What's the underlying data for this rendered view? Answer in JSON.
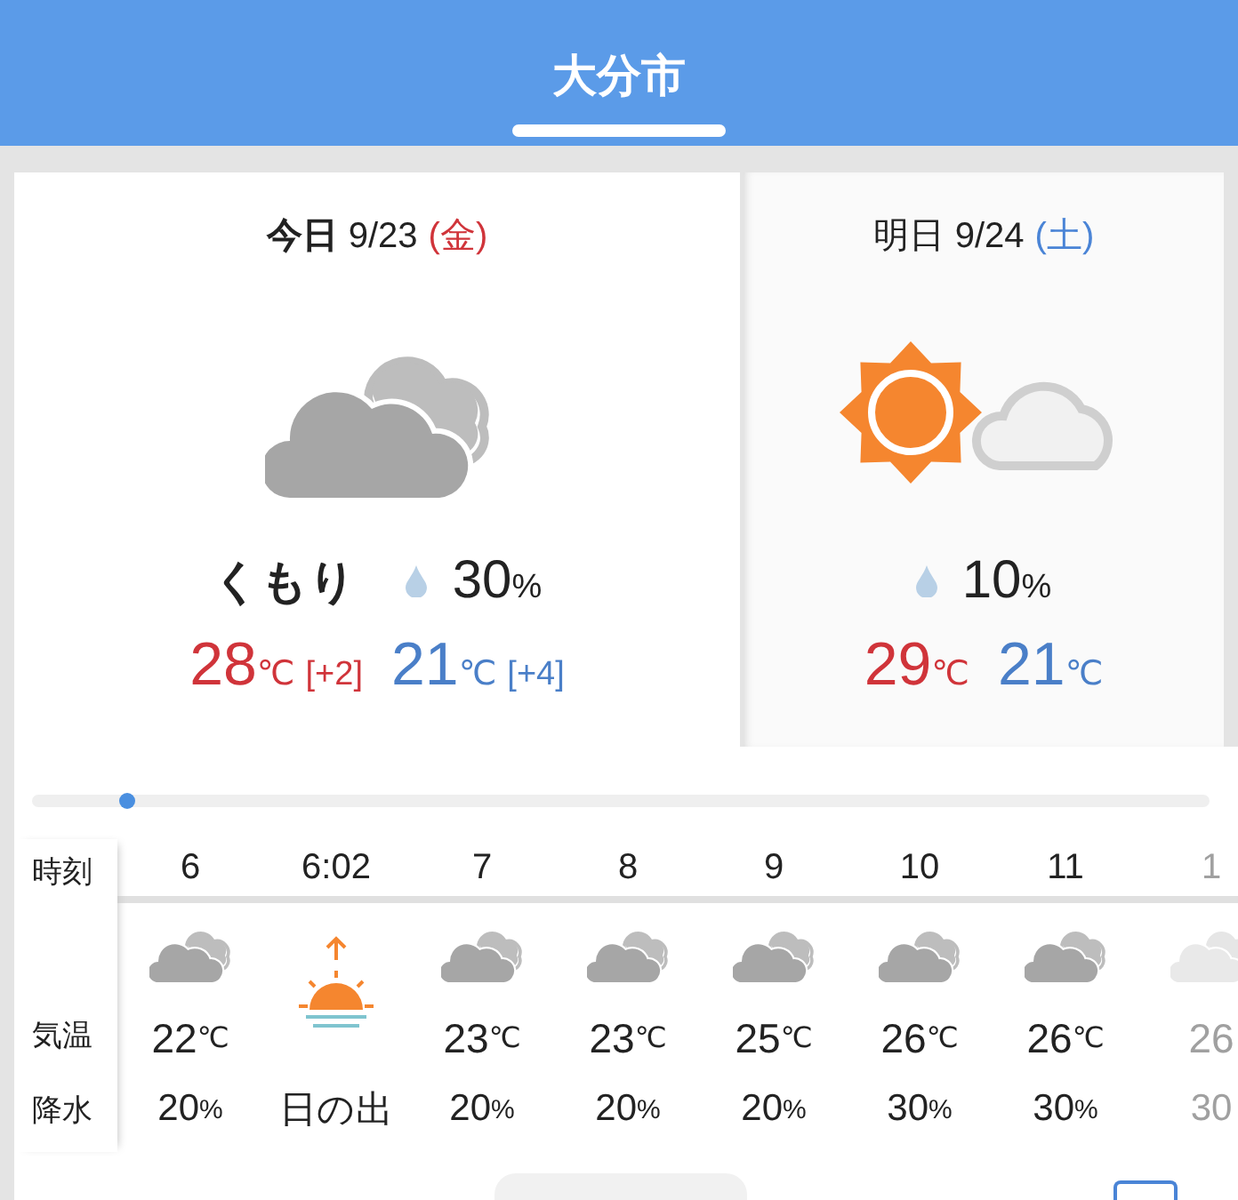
{
  "header": {
    "title": "大分市"
  },
  "days": [
    {
      "selected": true,
      "label": "今日",
      "date": "9/23",
      "weekday": "(金)",
      "color": "#d0343a",
      "kind": "cloudy",
      "condition": "くもり",
      "precip": "30",
      "precip_unit": "%",
      "high": {
        "temp": "28",
        "unit": "℃",
        "diff": "[+2]"
      },
      "low": {
        "temp": "21",
        "unit": "℃",
        "diff": "[+4]"
      }
    },
    {
      "selected": false,
      "label": "明日",
      "date": "9/24",
      "weekday": "(土)",
      "color": "#4a84d6",
      "kind": "sunny_cloudy",
      "precip": "10",
      "precip_unit": "%",
      "high": {
        "temp": "29",
        "unit": "℃"
      },
      "low": {
        "temp": "21",
        "unit": "℃"
      }
    }
  ],
  "timeline": {
    "level": 0.08
  },
  "hourly": {
    "row_labels": [
      "時刻",
      "気温",
      "降水"
    ],
    "columns": [
      {
        "kind": "hour",
        "time": "6",
        "temp": "22",
        "unit": "℃",
        "precip": "20",
        "precip_unit": "%"
      },
      {
        "kind": "sunrise",
        "time": "6:02",
        "label": "日の出"
      },
      {
        "kind": "hour",
        "time": "7",
        "temp": "23",
        "unit": "℃",
        "precip": "20",
        "precip_unit": "%"
      },
      {
        "kind": "hour",
        "time": "8",
        "temp": "23",
        "unit": "℃",
        "precip": "20",
        "precip_unit": "%"
      },
      {
        "kind": "hour",
        "time": "9",
        "temp": "25",
        "unit": "℃",
        "precip": "20",
        "precip_unit": "%"
      },
      {
        "kind": "hour",
        "time": "10",
        "temp": "26",
        "unit": "℃",
        "precip": "30",
        "precip_unit": "%"
      },
      {
        "kind": "hour",
        "time": "11",
        "temp": "26",
        "unit": "℃",
        "precip": "30",
        "precip_unit": "%"
      },
      {
        "kind": "hour",
        "time": "1",
        "temp": "26",
        "precip": "30"
      }
    ]
  }
}
